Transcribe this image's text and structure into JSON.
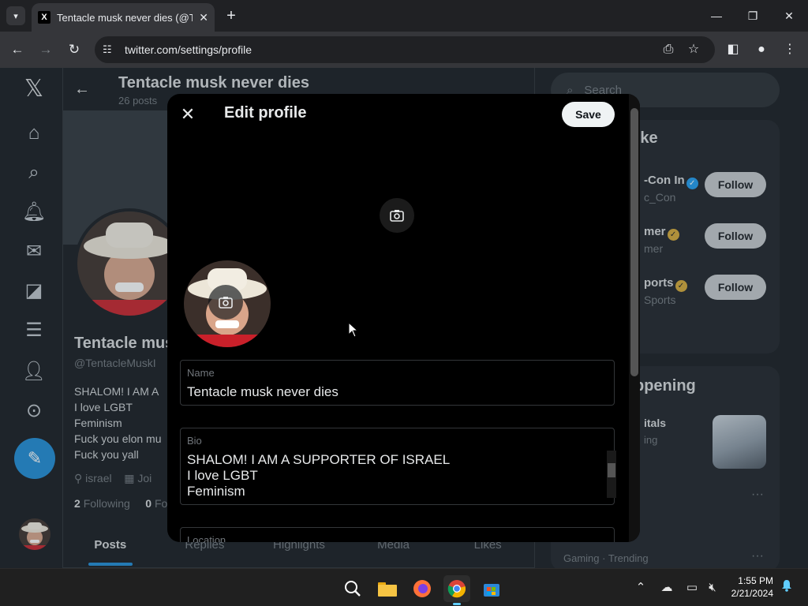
{
  "browser": {
    "tab_title": "Tentacle musk never dies (@Ter",
    "tab_favicon": "X",
    "url": "twitter.com/settings/profile"
  },
  "sidebar": {
    "logo": "𝕏",
    "icons": [
      "home-icon",
      "search-icon",
      "bell-icon",
      "mail-icon",
      "grok-icon",
      "lists-icon",
      "profile-icon",
      "more-icon"
    ],
    "compose_icon": "feather-plus-icon"
  },
  "profile_header": {
    "name": "Tentacle musk never dies",
    "posts": "26 posts"
  },
  "profile": {
    "name": "Tentacle mus",
    "handle": "@TentacleMuskI",
    "bio_lines": [
      "SHALOM! I AM A",
      "I love LGBT",
      "Feminism",
      "Fuck you elon mu",
      "Fuck you yall"
    ],
    "location": "israel",
    "joined": "Joi",
    "following_count": "2",
    "following_label": "Following",
    "followers_count": "0",
    "followers_label": "Fo",
    "tabs": [
      "Posts",
      "Replies",
      "Highlights",
      "Media",
      "Likes"
    ]
  },
  "right_panel": {
    "search_placeholder": "Search",
    "wtf_title": "t like",
    "suggestions": [
      {
        "name": "-Con In",
        "handle": "c_Con",
        "badge": "blue",
        "follow": "Follow"
      },
      {
        "name": "mer",
        "handle": "mer",
        "badge": "gold",
        "follow": "Follow"
      },
      {
        "name": "ports",
        "handle": "Sports",
        "badge": "gold",
        "follow": "Follow"
      }
    ],
    "happening_title": "ppening",
    "happening_topic": "itals",
    "happening_sub": "ing",
    "happening_more": "···",
    "trend_label": "Gaming · Trending",
    "trend_more": "···"
  },
  "modal": {
    "title": "Edit profile",
    "save_label": "Save",
    "name_label": "Name",
    "name_value": "Tentacle musk never dies",
    "bio_label": "Bio",
    "bio_lines": [
      "SHALOM! I AM A SUPPORTER OF ISRAEL",
      "I love LGBT",
      "Feminism"
    ],
    "location_label": "Location"
  },
  "taskbar": {
    "time": "1:55 PM",
    "date": "2/21/2024"
  },
  "colors": {
    "accent": "#1d8bd6",
    "verified_blue": "#1d9bf0",
    "verified_gold": "#d6a935",
    "modal_bg": "#000000"
  }
}
